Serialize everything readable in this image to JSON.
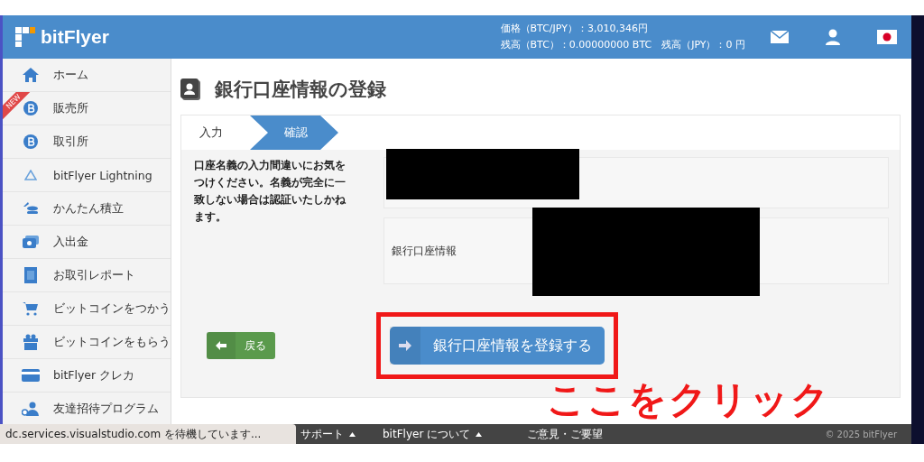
{
  "header": {
    "logo": "bitFlyer",
    "price": "価格（BTC/JPY）：3,010,346円",
    "balance_btc": "残高（BTC）：0.00000000 BTC",
    "balance_jpy": "残高（JPY）：0 円"
  },
  "sidebar": {
    "items": [
      {
        "label": "ホーム",
        "kind": "home"
      },
      {
        "label": "販売所",
        "kind": "coin",
        "badge": "NEW"
      },
      {
        "label": "取引所",
        "kind": "coin"
      },
      {
        "label": "bitFlyer Lightning",
        "kind": "triangle"
      },
      {
        "label": "かんたん積立",
        "kind": "stack"
      },
      {
        "label": "入出金",
        "kind": "cash"
      },
      {
        "label": "お取引レポート",
        "kind": "report"
      },
      {
        "label": "ビットコインをつかう",
        "kind": "cart"
      },
      {
        "label": "ビットコインをもらう",
        "kind": "gift"
      },
      {
        "label": "bitFlyer クレカ",
        "kind": "card"
      },
      {
        "label": "友達招待プログラム",
        "kind": "people"
      }
    ]
  },
  "page_title": "銀行口座情報の登録",
  "steps": [
    {
      "label": "入力",
      "selected": false
    },
    {
      "label": "確認",
      "selected": true
    }
  ],
  "notice": "口座名義の入力間違いにお気をつけください。名義が完全に一致しない場合は認証いたしかねます。",
  "fields": [
    {
      "kind": "blank"
    },
    {
      "kind": "labeled",
      "label": "銀行口座情報"
    }
  ],
  "back_button": "戻る",
  "submit_button": "銀行口座情報を登録する",
  "footer": {
    "items": [
      "サポート",
      "bitFlyer について"
    ],
    "feedback": "ご意見・ご要望",
    "copyright": "© 2025 bitFlyer"
  },
  "status_text": "dc.services.visualstudio.com を待機しています...",
  "annotation": "ここをクリック"
}
